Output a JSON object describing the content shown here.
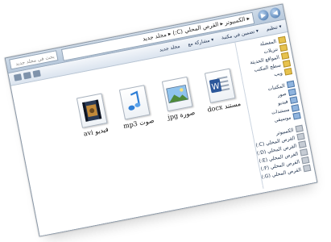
{
  "window": {
    "address": "▸ الكمبيوتر ▸ القرص المحلي (C:) ▸ مجلد جديد",
    "search_placeholder": "بحث في مجلد جديد",
    "nav_back_icon": "back-arrow-icon",
    "nav_forward_icon": "forward-arrow-icon"
  },
  "toolbar": {
    "organize": "تنظيم ▾",
    "include": "تضمين في مكتبة ▾",
    "share": "مشاركة مع ▾",
    "new_folder": "مجلد جديد"
  },
  "sidebar": {
    "favorites": [
      {
        "label": "المفضلة",
        "icon": "star-icon"
      },
      {
        "label": "تنزيلات",
        "icon": "download-folder-icon"
      },
      {
        "label": "المواقع الحديثة",
        "icon": "recent-places-icon"
      },
      {
        "label": "سطح المكتب",
        "icon": "desktop-icon"
      },
      {
        "label": "ويب",
        "icon": "folder-icon"
      }
    ],
    "libraries": [
      {
        "label": "المكتبات",
        "icon": "library-icon"
      },
      {
        "label": "صور",
        "icon": "pictures-icon"
      },
      {
        "label": "فيديو",
        "icon": "videos-icon"
      },
      {
        "label": "مستندات",
        "icon": "documents-icon"
      },
      {
        "label": "موسيقى",
        "icon": "music-icon"
      }
    ],
    "computer": [
      {
        "label": "الكمبيوتر",
        "icon": "computer-icon"
      },
      {
        "label": "القرص المحلي (C:)",
        "icon": "drive-icon"
      },
      {
        "label": "القرص المحلي (D:)",
        "icon": "drive-icon"
      },
      {
        "label": "القرص المحلي (E:)",
        "icon": "drive-icon"
      },
      {
        "label": "القرص المحلي (F:)",
        "icon": "drive-icon"
      },
      {
        "label": "القرص المحلي (G:)",
        "icon": "drive-icon"
      }
    ]
  },
  "files": [
    {
      "name": "docx مستند",
      "icon": "word-document-icon"
    },
    {
      "name": "jpg صورة",
      "icon": "image-file-icon"
    },
    {
      "name": "mp3 صوت",
      "icon": "audio-file-icon"
    },
    {
      "name": "avi فيديو",
      "icon": "video-file-icon"
    }
  ]
}
